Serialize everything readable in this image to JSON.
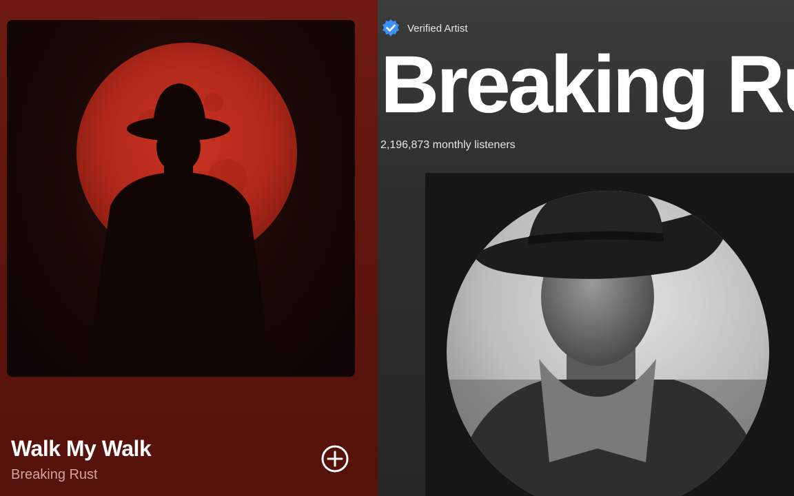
{
  "song": {
    "title": "Walk My Walk",
    "artist": "Breaking Rust",
    "cover_icon": "cowboy-silhouette-red-moon",
    "add_icon": "plus-circle-icon"
  },
  "artist_page": {
    "verified_label": "Verified Artist",
    "name": "Breaking Rust",
    "monthly_listeners": "2,196,873 monthly listeners",
    "photo_icon": "cowboy-portrait"
  },
  "colors": {
    "left_bg": "#6e1a12",
    "moon": "#b8291c",
    "verified_badge": "#3d91f4",
    "right_bg": "#2f2f2f"
  }
}
